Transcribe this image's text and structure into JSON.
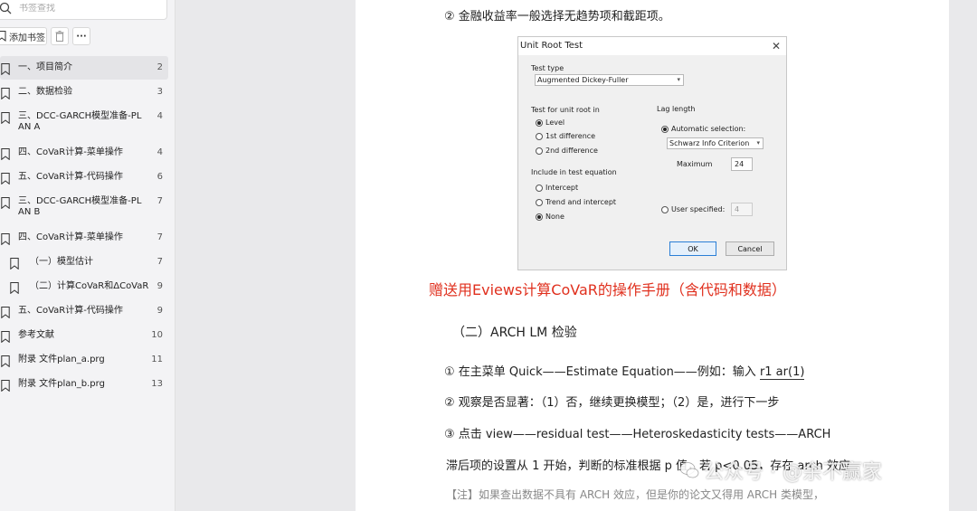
{
  "sidebar": {
    "search_placeholder": "书签查找",
    "add_bookmark_label": "添加书签",
    "more_label": "···",
    "items": [
      {
        "label": "一、项目简介",
        "page": "2"
      },
      {
        "label": "二、数据检验",
        "page": "3"
      },
      {
        "label": "三、DCC-GARCH模型准备-PLAN A",
        "page": "4"
      },
      {
        "label": "四、CoVaR计算-菜单操作",
        "page": "4"
      },
      {
        "label": "五、CoVaR计算-代码操作",
        "page": "6"
      },
      {
        "label": "三、DCC-GARCH模型准备-PLAN B",
        "page": "7"
      },
      {
        "label": "四、CoVaR计算-菜单操作",
        "page": "7"
      },
      {
        "label": "（一）模型估计",
        "page": "7"
      },
      {
        "label": "（二）计算CoVaR和ΔCoVaR",
        "page": "9"
      },
      {
        "label": "五、CoVaR计算-代码操作",
        "page": "9"
      },
      {
        "label": "参考文献",
        "page": "10"
      },
      {
        "label": "附录 文件plan_a.prg",
        "page": "11"
      },
      {
        "label": "附录 文件plan_b.prg",
        "page": "13"
      }
    ]
  },
  "document": {
    "line_top": "② 金融收益率一般选择无趋势项和截距项。",
    "promo": "赠送用Eviews计算CoVaR的操作手册（含代码和数据）",
    "heading": "（二）ARCH LM 检验",
    "step1_prefix": "① 在主菜单 Quick——Estimate Equation——例如：输入 ",
    "step1_code": "r1 ar(1)",
    "step2": "② 观察是否显著：（1）否，继续更换模型；（2）是，进行下一步",
    "step3": "③ 点击 view——residual test——Heteroskedasticity tests——ARCH",
    "lag_text": "滞后项的设置从 1 开始，判断的标准根据 p 值，若 p<0.05，存在 arch 效应",
    "note": "【注】如果查出数据不具有 ARCH 效应，但是你的论文又得用 ARCH 类模型，"
  },
  "dialog": {
    "title": "Unit Root Test",
    "test_type_label": "Test type",
    "test_type_value": "Augmented Dickey-Fuller",
    "unit_root_label": "Test for unit root in",
    "unit_root_options": [
      "Level",
      "1st difference",
      "2nd difference"
    ],
    "include_label": "Include in test equation",
    "include_options": [
      "Intercept",
      "Trend and intercept",
      "None"
    ],
    "lag_length_label": "Lag length",
    "auto_selection_label": "Automatic selection:",
    "criterion_value": "Schwarz Info Criterion",
    "maximum_label": "Maximum",
    "maximum_value": "24",
    "user_specified_label": "User specified:",
    "user_specified_value": "4",
    "ok_label": "OK",
    "cancel_label": "Cancel"
  },
  "watermark": {
    "text": "公众号 · @余不赢家"
  }
}
